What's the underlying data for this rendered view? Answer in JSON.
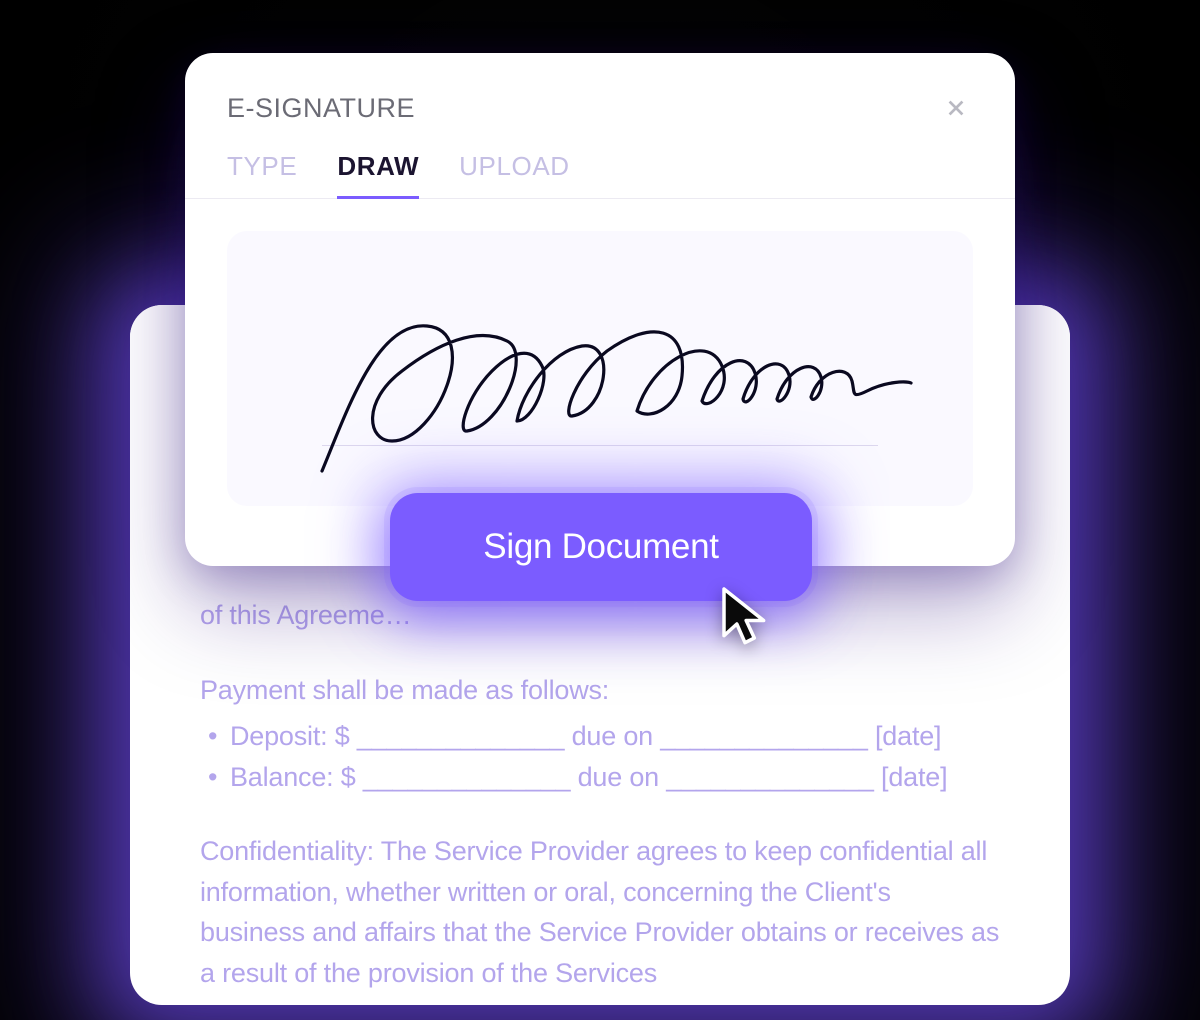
{
  "modal": {
    "title": "E-SIGNATURE",
    "tabs": [
      "TYPE",
      "DRAW",
      "UPLOAD"
    ],
    "active_tab_index": 1,
    "close_label": "Close"
  },
  "sign_button": {
    "label": "Sign Document"
  },
  "document": {
    "truncated_top": "of this Agreeme…",
    "payment_intro": "Payment shall be made as follows:",
    "bullets": [
      "Deposit: $ ______________ due on ______________ [date]",
      "Balance: $ ______________ due on ______________ [date]"
    ],
    "confidentiality": "Confidentiality: The Service Provider agrees to keep confidential all information, whether written or oral, concerning the Client's business and affairs that the Service Provider obtains or receives as a result of the provision of the Services"
  },
  "colors": {
    "accent": "#7b5cff",
    "doc_text": "#b3a5ec"
  }
}
